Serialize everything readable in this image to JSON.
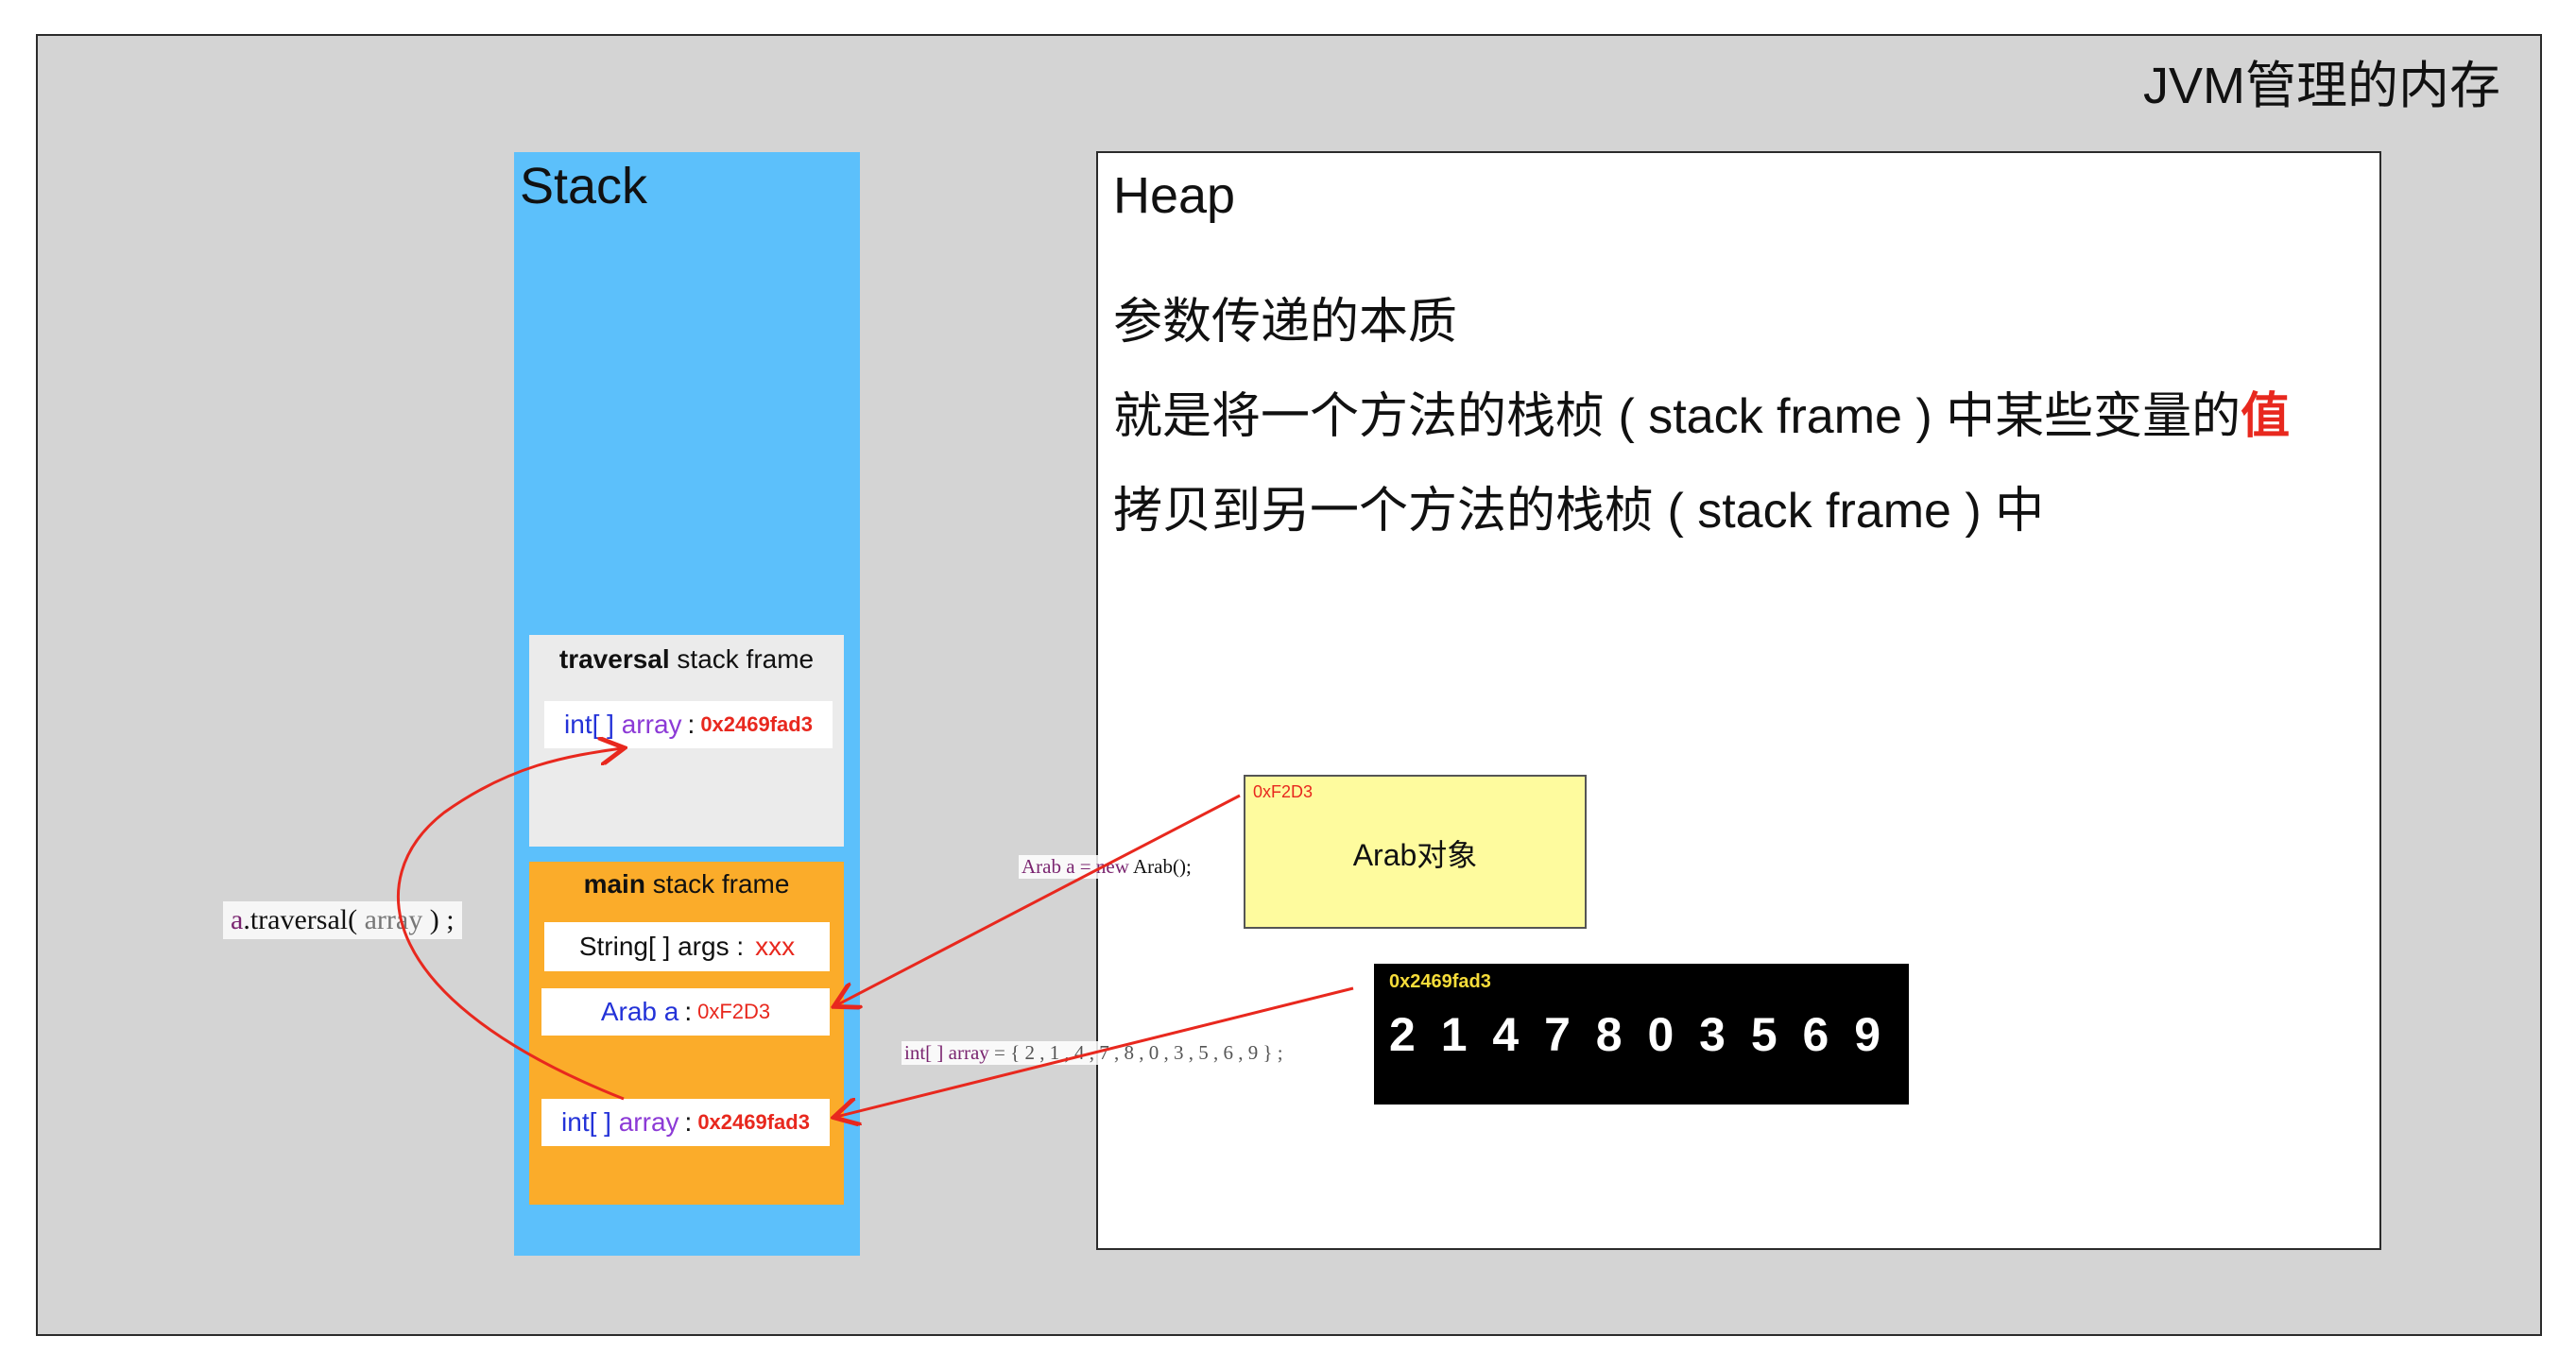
{
  "jvm_label": "JVM管理的内存",
  "stack": {
    "title": "Stack",
    "traversal_frame": {
      "title_bold": "traversal",
      "title_rest": " stack frame",
      "slot": {
        "type": "int[ ]",
        "name": "array",
        "colon": ":",
        "value": "0x2469fad3"
      }
    },
    "main_frame": {
      "title_bold": "main",
      "title_rest": " stack frame",
      "args_slot": {
        "text": "String[ ] args :",
        "value": "xxx"
      },
      "arab_slot": {
        "type": "Arab",
        "name": "a",
        "colon": ":",
        "value": "0xF2D3"
      },
      "array_slot": {
        "type": "int[ ]",
        "name": "array",
        "colon": ":",
        "value": "0x2469fad3"
      }
    }
  },
  "heap": {
    "title": "Heap",
    "line1": "参数传递的本质",
    "line2_prefix": "就是将一个方法的栈桢 ( stack frame ) 中某些变量的",
    "line2_emphasis": "值",
    "line3": "拷贝到另一个方法的栈桢 ( stack frame ) 中"
  },
  "code": {
    "call_receiver": "a",
    "call_method": ".traversal(",
    "call_arg": " array ",
    "call_end": ") ;",
    "new_arab_decl": "Arab a = ",
    "new_arab_kw": "new",
    "new_arab_rest": " Arab();",
    "array_decl_type": "int[ ] array",
    "array_decl_rest": " = { 2 , 1 , 4 , 7 , 8 , 0 , 3 , 5 , 6 , 9 } ;"
  },
  "objects": {
    "arab": {
      "address": "0xF2D3",
      "label": "Arab对象"
    },
    "array": {
      "address": "0x2469fad3",
      "values": [
        "2",
        "1",
        "4",
        "7",
        "8",
        "0",
        "3",
        "5",
        "6",
        "9"
      ]
    }
  },
  "colors": {
    "jvm_background": "#d4d4d4",
    "stack_blue": "#5cc0fb",
    "traversal_frame": "#ebebeb",
    "main_frame_orange": "#fbac2a",
    "arab_object_yellow": "#fefb9e",
    "array_object_black": "#000000",
    "arrow_red": "#e8281e",
    "keyword_blue": "#2332d8",
    "identifier_purple": "#8c3ad6"
  }
}
